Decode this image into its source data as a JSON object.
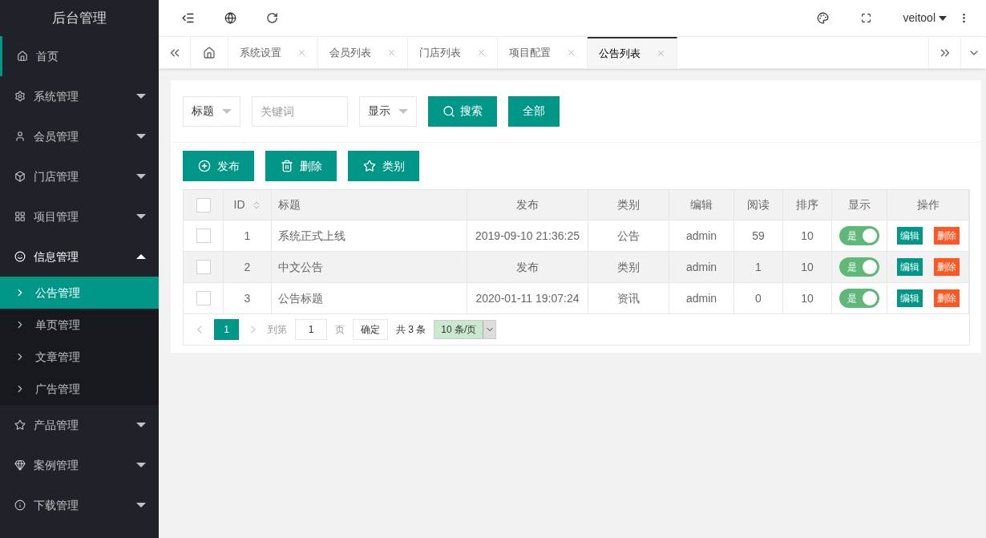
{
  "sidebar": {
    "title": "后台管理",
    "items": [
      {
        "label": "首页",
        "selected": true,
        "expanded": false,
        "has_children": false
      },
      {
        "label": "系统管理",
        "selected": false,
        "expanded": false,
        "has_children": true
      },
      {
        "label": "会员管理",
        "selected": false,
        "expanded": false,
        "has_children": true
      },
      {
        "label": "门店管理",
        "selected": false,
        "expanded": false,
        "has_children": true
      },
      {
        "label": "项目管理",
        "selected": false,
        "expanded": false,
        "has_children": true
      },
      {
        "label": "信息管理",
        "selected": false,
        "expanded": true,
        "has_children": true,
        "children": [
          {
            "label": "公告管理",
            "selected": true
          },
          {
            "label": "单页管理",
            "selected": false
          },
          {
            "label": "文章管理",
            "selected": false
          },
          {
            "label": "广告管理",
            "selected": false
          }
        ]
      },
      {
        "label": "产品管理",
        "selected": false,
        "expanded": false,
        "has_children": true
      },
      {
        "label": "案例管理",
        "selected": false,
        "expanded": false,
        "has_children": true
      },
      {
        "label": "下载管理",
        "selected": false,
        "expanded": false,
        "has_children": true
      }
    ]
  },
  "header": {
    "user": "veitool"
  },
  "tabs": [
    {
      "label": "系统设置",
      "selected": false
    },
    {
      "label": "会员列表",
      "selected": false
    },
    {
      "label": "门店列表",
      "selected": false
    },
    {
      "label": "项目配置",
      "selected": false
    },
    {
      "label": "公告列表",
      "selected": true
    }
  ],
  "filters": {
    "field_select": "标题",
    "keyword": {
      "placeholder": "关键词"
    },
    "display_select": "显示",
    "search_button": "搜索",
    "all_button": "全部"
  },
  "toolbar": [
    "发布",
    "删除",
    "类别"
  ],
  "table": {
    "columns": [
      "ID",
      "标题",
      "发布",
      "类别",
      "编辑",
      "阅读",
      "排序",
      "显示",
      "操作"
    ],
    "header_checked": false,
    "rows": [
      {
        "checked": false,
        "highlighted": false,
        "id": "1",
        "title": "系统正式上线",
        "published": "2019-09-10 21:36:25",
        "category": "公告",
        "editor": "admin",
        "reads": "59",
        "order": "10",
        "display": {
          "label": "是",
          "on": true
        },
        "actions": [
          "编辑",
          "删除"
        ]
      },
      {
        "checked": false,
        "highlighted": true,
        "id": "2",
        "title": "中文公告",
        "published": "发布",
        "category": "类别",
        "editor": "admin",
        "reads": "1",
        "order": "10",
        "display": {
          "label": "是",
          "on": true
        },
        "actions": [
          "编辑",
          "删除"
        ]
      },
      {
        "checked": false,
        "highlighted": false,
        "id": "3",
        "title": "公告标题",
        "published": "2020-01-11 19:07:24",
        "category": "资讯",
        "editor": "admin",
        "reads": "0",
        "order": "10",
        "display": {
          "label": "是",
          "on": true
        },
        "actions": [
          "编辑",
          "删除"
        ]
      }
    ]
  },
  "pagination": {
    "pages": [
      {
        "label": "1",
        "selected": true
      }
    ],
    "goto_label": "到第",
    "goto_value": "1",
    "page_label": "页",
    "confirm": "确定",
    "total": "共 3 条",
    "page_size": "10 条/页"
  }
}
